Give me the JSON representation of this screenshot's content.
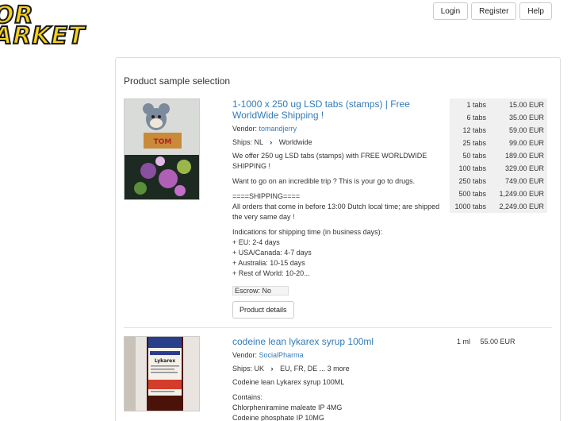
{
  "logo": {
    "line1": "OR",
    "line2": "ARKET"
  },
  "header": {
    "login": "Login",
    "register": "Register",
    "help": "Help"
  },
  "panel": {
    "title": "Product sample selection"
  },
  "listings": [
    {
      "title": "1-1000 x 250 ug LSD tabs (stamps) | Free WorldWide Shipping !",
      "vendor_label": "Vendor:",
      "vendor": "tomandjerry",
      "ships_from": "Ships: NL",
      "ships_to": "Worldwide",
      "desc": [
        "We offer 250 ug LSD tabs (stamps) with FREE WORLDWIDE SHIPPING !",
        "Want to go on an incredible trip ? This is your go to drugs.",
        "====SHIPPING====\nAll orders that come in before 13:00 Dutch local time; are shipped the very same day !",
        "Indications for shipping time (in business days):\n+ EU: 2-4 days\n+ USA/Canada: 4-7 days\n+ Australia: 10-15 days\n+ Rest of World: 10-20..."
      ],
      "escrow": "Escrow: No",
      "details_button": "Product details",
      "prices": [
        {
          "qty": "1 tabs",
          "amount": "15.00 EUR"
        },
        {
          "qty": "6 tabs",
          "amount": "35.00 EUR"
        },
        {
          "qty": "12 tabs",
          "amount": "59.00 EUR"
        },
        {
          "qty": "25 tabs",
          "amount": "99.00 EUR"
        },
        {
          "qty": "50 tabs",
          "amount": "189.00 EUR"
        },
        {
          "qty": "100 tabs",
          "amount": "329.00 EUR"
        },
        {
          "qty": "250 tabs",
          "amount": "749.00 EUR"
        },
        {
          "qty": "500 tabs",
          "amount": "1,249.00 EUR"
        },
        {
          "qty": "1000 tabs",
          "amount": "2,249.00 EUR"
        }
      ]
    },
    {
      "title": "codeine lean lykarex syrup 100ml",
      "vendor_label": "Vendor:",
      "vendor": "SocialPharma",
      "ships_from": "Ships: UK",
      "ships_to": "EU, FR, DE ... 3 more",
      "desc": [
        "Codeine lean Lykarex syrup 100ML",
        "Contains:\nChlorpheniramine maleate IP 4MG\nCodeine phosphate IP 10MG"
      ],
      "prices": [
        {
          "qty": "1 ml",
          "amount": "55.00 EUR"
        }
      ]
    }
  ]
}
